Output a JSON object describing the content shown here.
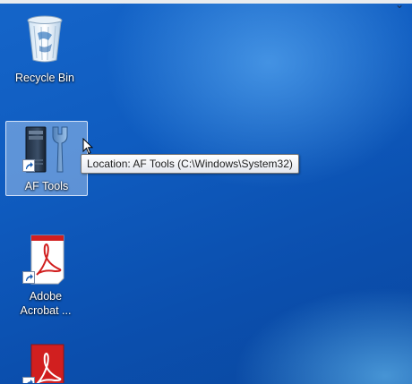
{
  "desktop": {
    "icons": [
      {
        "label": "Recycle Bin",
        "icon": "recycle-bin-icon"
      },
      {
        "label": "AF Tools",
        "icon": "af-tools-icon",
        "selected": true,
        "shortcut": true
      },
      {
        "label": "Adobe Acrobat ...",
        "icon": "adobe-acrobat-icon",
        "shortcut": true
      },
      {
        "label": "",
        "icon": "adobe-acrobat-icon",
        "shortcut": true
      }
    ],
    "tooltip": "Location: AF Tools (C:\\Windows\\System32)"
  },
  "colors": {
    "wallpaper": "#0f5cc0",
    "selection": "#bed7f5",
    "acrobat_red": "#d11f1f"
  }
}
